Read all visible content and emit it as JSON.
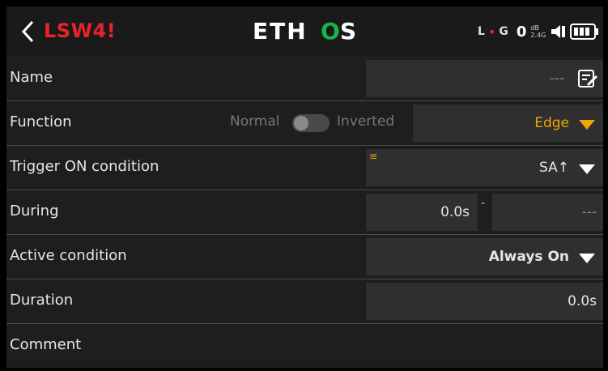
{
  "header": {
    "title": "LSW4",
    "title_suffix": "!",
    "logo_text": "ETHOS",
    "status": {
      "l": "L",
      "dot": "•",
      "g": "G",
      "rssi": "0",
      "unit_db": "dB",
      "band": "2.4G"
    }
  },
  "fields": {
    "name": {
      "label": "Name",
      "value": "---"
    },
    "function": {
      "label": "Function",
      "normal": "Normal",
      "inverted": "Inverted",
      "value": "Edge"
    },
    "trigger_on": {
      "label": "Trigger ON condition",
      "value": "SA↑",
      "marker": "≡"
    },
    "during": {
      "label": "During",
      "value1": "0.0s",
      "sep": "-",
      "value2": "---"
    },
    "active": {
      "label": "Active condition",
      "value": "Always On"
    },
    "duration": {
      "label": "Duration",
      "value": "0.0s"
    },
    "comment": {
      "label": "Comment"
    }
  },
  "colors": {
    "accent": "#f2a500",
    "title_red": "#e8242a",
    "logo_green": "#19b34a"
  }
}
